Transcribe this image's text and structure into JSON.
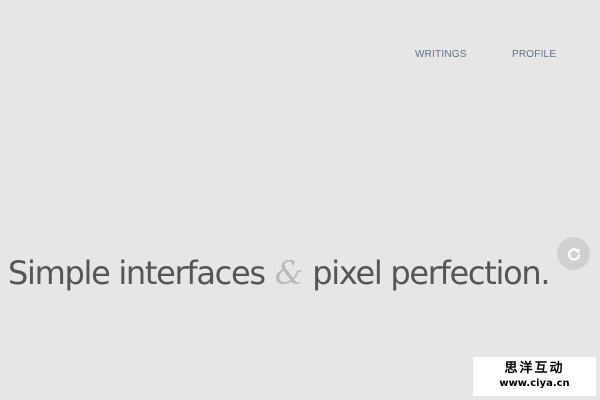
{
  "nav": {
    "items": [
      {
        "label": "WRITINGS"
      },
      {
        "label": "PROFILE"
      }
    ]
  },
  "hero": {
    "part1": "Simple interfaces",
    "ampersand": "&",
    "part2": "pixel perfection."
  },
  "refresh_button": {
    "icon": "refresh-icon"
  },
  "watermark": {
    "title": "思洋互动",
    "url": "www.ciya.cn"
  },
  "colors": {
    "background": "#e6e6e6",
    "nav_link": "#5c7186",
    "hero_text": "#555555",
    "ampersand": "#b9b9b9",
    "button_bg": "#d0d0d0"
  }
}
